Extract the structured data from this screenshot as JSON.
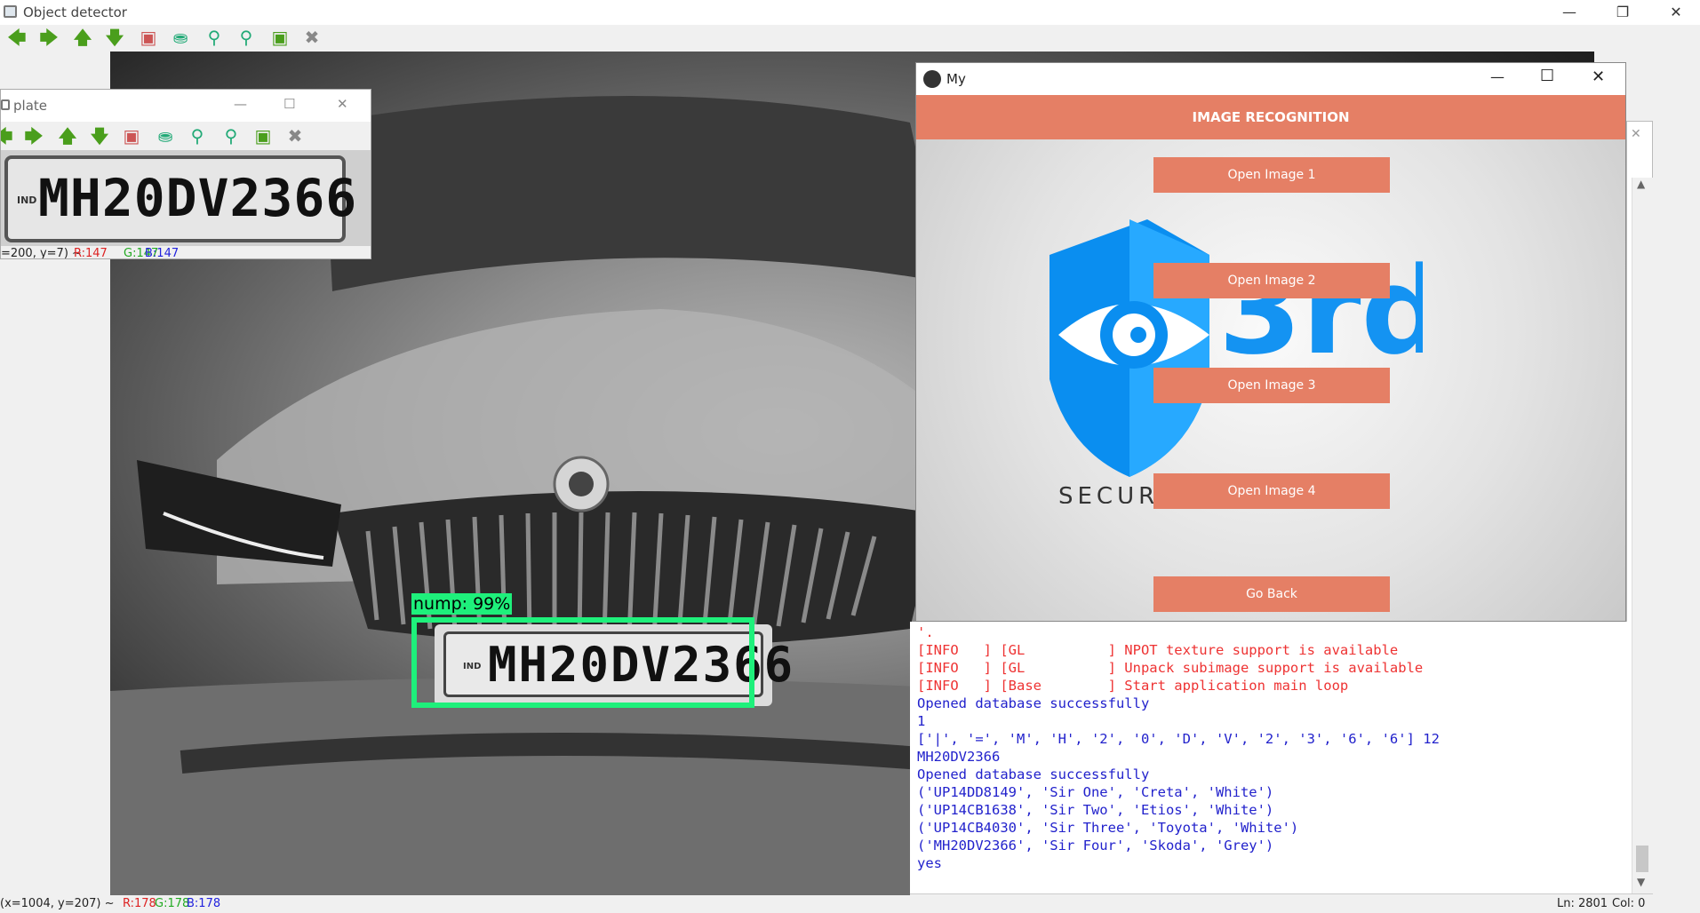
{
  "main_window": {
    "title": "Object detector",
    "status": "(x=1004, y=207) ~",
    "status_r": "R:178",
    "status_g": "G:178",
    "status_b": "B:178"
  },
  "toolbar_icons": [
    "arrow-left-icon",
    "arrow-right-icon",
    "arrow-up-icon",
    "arrow-down-icon",
    "image-icon",
    "zoom-fit-icon",
    "zoom-in-icon",
    "zoom-out-icon",
    "save-icon",
    "properties-icon"
  ],
  "detection": {
    "label": "nump: 99%",
    "plate_text": "MH20DV2366",
    "plate_country": "IND"
  },
  "plate_window": {
    "title": "plate",
    "plate_text": "MH20DV2366",
    "plate_country": "IND",
    "status": "=200, y=7) ~",
    "status_r": "R:147",
    "status_g": "G:147",
    "status_b": "B:147"
  },
  "kivy_window": {
    "title": "My",
    "header": "IMAGE RECOGNITION",
    "buttons": [
      "Open Image 1",
      "Open Image 2",
      "Open Image 3",
      "Open Image 4"
    ],
    "back_label": "Go Back",
    "logo_text": "3rd eye",
    "logo_subtitle": "SECURITY SYSTEMS",
    "colors": {
      "accent": "#e57f65",
      "logo_blue": "#0a8ef0"
    }
  },
  "console": {
    "lines": [
      {
        "text": "'.",
        "color": "red"
      },
      {
        "text": "[INFO   ] [GL          ] NPOT texture support is available",
        "color": "red"
      },
      {
        "text": "[INFO   ] [GL          ] Unpack subimage support is available",
        "color": "red"
      },
      {
        "text": "[INFO   ] [Base        ] Start application main loop",
        "color": "red"
      },
      {
        "text": "Opened database successfully",
        "color": "blue"
      },
      {
        "text": "1",
        "color": "blue"
      },
      {
        "text": "['|', '=', 'M', 'H', '2', '0', 'D', 'V', '2', '3', '6', '6'] 12",
        "color": "blue"
      },
      {
        "text": "MH20DV2366",
        "color": "blue"
      },
      {
        "text": "Opened database successfully",
        "color": "blue"
      },
      {
        "text": "('UP14DD8149', 'Sir One', 'Creta', 'White')",
        "color": "blue"
      },
      {
        "text": "('UP14CB1638', 'Sir Two', 'Etios', 'White')",
        "color": "blue"
      },
      {
        "text": "('UP14CB4030', 'Sir Three', 'Toyota', 'White')",
        "color": "blue"
      },
      {
        "text": "('MH20DV2366', 'Sir Four', 'Skoda', 'Grey')",
        "color": "blue"
      },
      {
        "text": "yes",
        "color": "blue"
      }
    ],
    "status_ln": "Ln: 2801",
    "status_col": "Col: 0"
  }
}
